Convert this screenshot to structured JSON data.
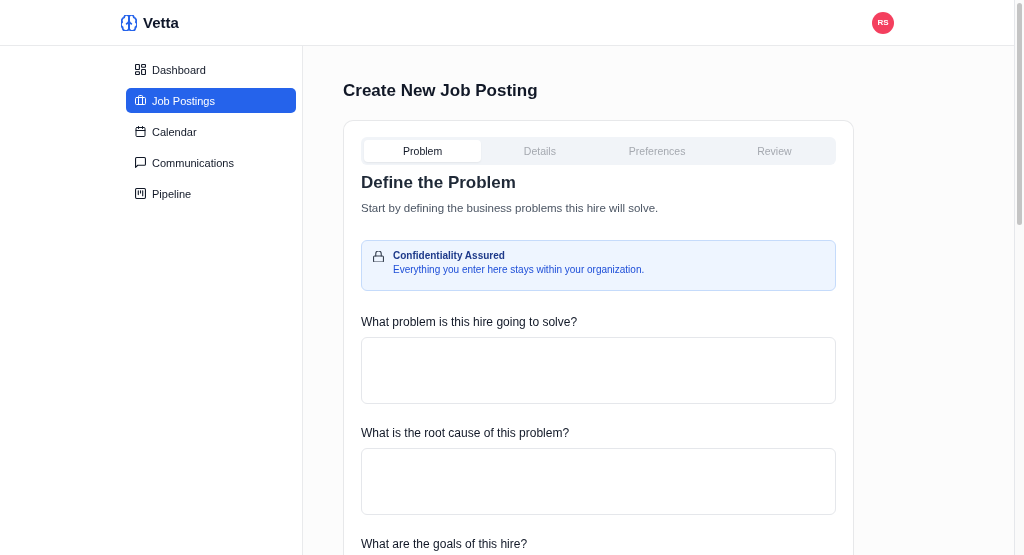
{
  "app": {
    "name": "Vetta",
    "user_initials": "RS"
  },
  "sidebar": {
    "items": [
      {
        "label": "Dashboard",
        "selected": false
      },
      {
        "label": "Job Postings",
        "selected": true
      },
      {
        "label": "Calendar",
        "selected": false
      },
      {
        "label": "Communications",
        "selected": false
      },
      {
        "label": "Pipeline",
        "selected": false
      }
    ]
  },
  "page": {
    "title": "Create New Job Posting"
  },
  "steps": [
    {
      "label": "Problem",
      "selected": true
    },
    {
      "label": "Details",
      "selected": false
    },
    {
      "label": "Preferences",
      "selected": false
    },
    {
      "label": "Review",
      "selected": false
    }
  ],
  "section": {
    "title": "Define the Problem",
    "description": "Start by defining the business problems this hire will solve."
  },
  "notice": {
    "title": "Confidentiality Assured",
    "text": "Everything you enter here stays within your organization."
  },
  "questions": [
    {
      "label": "What problem is this hire going to solve?"
    },
    {
      "label": "What is the root cause of this problem?"
    }
  ],
  "next_question": {
    "label": "What are the goals of this hire?"
  }
}
